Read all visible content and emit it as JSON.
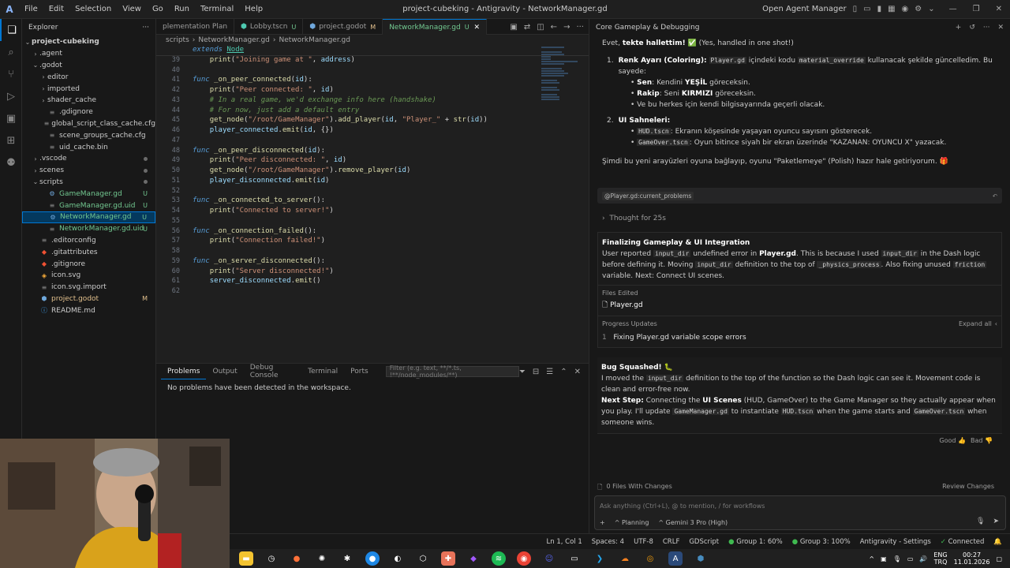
{
  "window": {
    "title": "project-cubeking - Antigravity - NetworkManager.gd",
    "menu": [
      "File",
      "Edit",
      "Selection",
      "View",
      "Go",
      "Run",
      "Terminal",
      "Help"
    ],
    "open_agent_manager": "Open Agent Manager"
  },
  "explorer": {
    "header": "Explorer",
    "root": "project-cubeking",
    "items": [
      {
        "label": ".agent",
        "indent": 1,
        "type": "folder",
        "open": false,
        "status": ""
      },
      {
        "label": ".godot",
        "indent": 1,
        "type": "folder",
        "open": true,
        "status": ""
      },
      {
        "label": "editor",
        "indent": 2,
        "type": "folder",
        "open": false,
        "status": ""
      },
      {
        "label": "imported",
        "indent": 2,
        "type": "folder",
        "open": false,
        "status": ""
      },
      {
        "label": "shader_cache",
        "indent": 2,
        "type": "folder",
        "open": false,
        "status": ""
      },
      {
        "label": ".gdignore",
        "indent": 2,
        "type": "file",
        "status": ""
      },
      {
        "label": "global_script_class_cache.cfg",
        "indent": 2,
        "type": "file",
        "status": ""
      },
      {
        "label": "scene_groups_cache.cfg",
        "indent": 2,
        "type": "file",
        "status": ""
      },
      {
        "label": "uid_cache.bin",
        "indent": 2,
        "type": "file",
        "status": ""
      },
      {
        "label": ".vscode",
        "indent": 1,
        "type": "folder",
        "open": false,
        "status": "dot"
      },
      {
        "label": "scenes",
        "indent": 1,
        "type": "folder",
        "open": false,
        "status": "dot"
      },
      {
        "label": "scripts",
        "indent": 1,
        "type": "folder",
        "open": true,
        "status": "dot"
      },
      {
        "label": "GameManager.gd",
        "indent": 2,
        "type": "file",
        "status": "U"
      },
      {
        "label": "GameManager.gd.uid",
        "indent": 2,
        "type": "file",
        "status": "U"
      },
      {
        "label": "NetworkManager.gd",
        "indent": 2,
        "type": "file",
        "status": "U",
        "selected": true
      },
      {
        "label": "NetworkManager.gd.uid",
        "indent": 2,
        "type": "file",
        "status": "U"
      },
      {
        "label": ".editorconfig",
        "indent": 1,
        "type": "file",
        "status": ""
      },
      {
        "label": ".gitattributes",
        "indent": 1,
        "type": "file",
        "status": ""
      },
      {
        "label": ".gitignore",
        "indent": 1,
        "type": "file",
        "status": ""
      },
      {
        "label": "icon.svg",
        "indent": 1,
        "type": "file",
        "status": ""
      },
      {
        "label": "icon.svg.import",
        "indent": 1,
        "type": "file",
        "status": ""
      },
      {
        "label": "project.godot",
        "indent": 1,
        "type": "file",
        "status": "M"
      },
      {
        "label": "README.md",
        "indent": 1,
        "type": "file",
        "status": ""
      }
    ]
  },
  "tabs": [
    {
      "label": "plementation Plan",
      "status": "",
      "active": false
    },
    {
      "label": "Lobby.tscn",
      "status": "U",
      "active": false
    },
    {
      "label": "project.godot",
      "status": "M",
      "active": false
    },
    {
      "label": "NetworkManager.gd",
      "status": "U",
      "active": true
    }
  ],
  "breadcrumb": [
    "scripts",
    "NetworkManager.gd",
    "NetworkManager.gd"
  ],
  "sticky_line": {
    "kw": "extends",
    "name": "Node"
  },
  "code_lines": [
    {
      "n": "39",
      "t": [
        [
          "",
          "    "
        ],
        [
          "fn",
          "print"
        ],
        [
          "",
          "("
        ],
        [
          "str",
          "\"Joining game at \""
        ],
        [
          "",
          ", "
        ],
        [
          "id",
          "address"
        ],
        [
          "",
          ")"
        ]
      ]
    },
    {
      "n": "40",
      "t": []
    },
    {
      "n": "41",
      "t": [
        [
          "kw",
          "func"
        ],
        [
          "",
          " "
        ],
        [
          "fn",
          "_on_peer_connected"
        ],
        [
          "",
          "("
        ],
        [
          "id",
          "id"
        ],
        [
          "",
          "):"
        ]
      ]
    },
    {
      "n": "42",
      "t": [
        [
          "",
          "    "
        ],
        [
          "fn",
          "print"
        ],
        [
          "",
          "("
        ],
        [
          "str",
          "\"Peer connected: \""
        ],
        [
          "",
          ", "
        ],
        [
          "id",
          "id"
        ],
        [
          "",
          ")"
        ]
      ]
    },
    {
      "n": "43",
      "t": [
        [
          "cm",
          "    # In a real game, we'd exchange info here (handshake)"
        ]
      ]
    },
    {
      "n": "44",
      "t": [
        [
          "cm",
          "    # For now, just add a default entry"
        ]
      ]
    },
    {
      "n": "45",
      "t": [
        [
          "",
          "    "
        ],
        [
          "fn",
          "get_node"
        ],
        [
          "",
          "("
        ],
        [
          "str",
          "\"/root/GameManager\""
        ],
        [
          "",
          ")."
        ],
        [
          "fn",
          "add_player"
        ],
        [
          "",
          "("
        ],
        [
          "id",
          "id"
        ],
        [
          "",
          ", "
        ],
        [
          "str",
          "\"Player_\""
        ],
        [
          "",
          " + "
        ],
        [
          "fn",
          "str"
        ],
        [
          "",
          "("
        ],
        [
          "id",
          "id"
        ],
        [
          "",
          "))"
        ]
      ]
    },
    {
      "n": "46",
      "t": [
        [
          "",
          "    "
        ],
        [
          "id",
          "player_connected"
        ],
        [
          "",
          "."
        ],
        [
          "fn",
          "emit"
        ],
        [
          "",
          "("
        ],
        [
          "id",
          "id"
        ],
        [
          "",
          ", {})"
        ]
      ]
    },
    {
      "n": "47",
      "t": []
    },
    {
      "n": "48",
      "t": [
        [
          "kw",
          "func"
        ],
        [
          "",
          " "
        ],
        [
          "fn",
          "_on_peer_disconnected"
        ],
        [
          "",
          "("
        ],
        [
          "id",
          "id"
        ],
        [
          "",
          "):"
        ]
      ]
    },
    {
      "n": "49",
      "t": [
        [
          "",
          "    "
        ],
        [
          "fn",
          "print"
        ],
        [
          "",
          "("
        ],
        [
          "str",
          "\"Peer disconnected: \""
        ],
        [
          "",
          ", "
        ],
        [
          "id",
          "id"
        ],
        [
          "",
          ")"
        ]
      ]
    },
    {
      "n": "50",
      "t": [
        [
          "",
          "    "
        ],
        [
          "fn",
          "get_node"
        ],
        [
          "",
          "("
        ],
        [
          "str",
          "\"/root/GameManager\""
        ],
        [
          "",
          ")."
        ],
        [
          "fn",
          "remove_player"
        ],
        [
          "",
          "("
        ],
        [
          "id",
          "id"
        ],
        [
          "",
          ")"
        ]
      ]
    },
    {
      "n": "51",
      "t": [
        [
          "",
          "    "
        ],
        [
          "id",
          "player_disconnected"
        ],
        [
          "",
          "."
        ],
        [
          "fn",
          "emit"
        ],
        [
          "",
          "("
        ],
        [
          "id",
          "id"
        ],
        [
          "",
          ")"
        ]
      ]
    },
    {
      "n": "52",
      "t": []
    },
    {
      "n": "53",
      "t": [
        [
          "kw",
          "func"
        ],
        [
          "",
          " "
        ],
        [
          "fn",
          "_on_connected_to_server"
        ],
        [
          "",
          "():"
        ]
      ]
    },
    {
      "n": "54",
      "t": [
        [
          "",
          "    "
        ],
        [
          "fn",
          "print"
        ],
        [
          "",
          "("
        ],
        [
          "str",
          "\"Connected to server!\""
        ],
        [
          "",
          ")"
        ]
      ]
    },
    {
      "n": "55",
      "t": []
    },
    {
      "n": "56",
      "t": [
        [
          "kw",
          "func"
        ],
        [
          "",
          " "
        ],
        [
          "fn",
          "_on_connection_failed"
        ],
        [
          "",
          "():"
        ]
      ]
    },
    {
      "n": "57",
      "t": [
        [
          "",
          "    "
        ],
        [
          "fn",
          "print"
        ],
        [
          "",
          "("
        ],
        [
          "str",
          "\"Connection failed!\""
        ],
        [
          "",
          ")"
        ]
      ]
    },
    {
      "n": "58",
      "t": []
    },
    {
      "n": "59",
      "t": [
        [
          "kw",
          "func"
        ],
        [
          "",
          " "
        ],
        [
          "fn",
          "_on_server_disconnected"
        ],
        [
          "",
          "():"
        ]
      ]
    },
    {
      "n": "60",
      "t": [
        [
          "",
          "    "
        ],
        [
          "fn",
          "print"
        ],
        [
          "",
          "("
        ],
        [
          "str",
          "\"Server disconnected!\""
        ],
        [
          "",
          ")"
        ]
      ]
    },
    {
      "n": "61",
      "t": [
        [
          "",
          "    "
        ],
        [
          "id",
          "server_disconnected"
        ],
        [
          "",
          "."
        ],
        [
          "fn",
          "emit"
        ],
        [
          "",
          "()"
        ]
      ]
    },
    {
      "n": "62",
      "t": []
    }
  ],
  "panel": {
    "tabs": [
      "Problems",
      "Output",
      "Debug Console",
      "Terminal",
      "Ports"
    ],
    "filter_placeholder": "Filter (e.g. text, **/*.ts, !**/node_modules/**)",
    "message": "No problems have been detected in the workspace."
  },
  "agent": {
    "header": "Core Gameplay & Debugging",
    "intro_pre": "Evet, ",
    "intro_bold": "tekte hallettim!",
    "intro_post": " ✅ (Yes, handled in one shot!)",
    "item1_bold": "Renk Ayarı (Coloring):",
    "item1_code1": "Player.gd",
    "item1_mid": " içindeki kodu ",
    "item1_code2": "material_override",
    "item1_post": " kullanacak şekilde güncelledim. Bu sayede:",
    "b1_bold": "Sen",
    "b1_pre": ": Kendini ",
    "b1_bold2": "YEŞİL",
    "b1_post": " göreceksin.",
    "b2_bold": "Rakip",
    "b2_pre": ": Seni ",
    "b2_bold2": "KIRMIZI",
    "b2_post": " göreceksin.",
    "b3": "Ve bu herkes için kendi bilgisayarında geçerli olacak.",
    "item2_bold": "UI Sahneleri:",
    "c1_code": "HUD.tscn",
    "c1_post": ": Ekranın köşesinde yaşayan oyuncu sayısını gösterecek.",
    "c2_code": "GameOver.tscn",
    "c2_post": ": Oyun bitince siyah bir ekran üzerinde \"KAZANAN: OYUNCU X\" yazacak.",
    "closing": "Şimdi bu yeni arayüzleri oyuna bağlayıp, oyunu \"Paketlemeye\" (Polish) hazır hale getiriyorum. 🎁",
    "mention": "@Player.gd:current_problems",
    "thought": "Thought for 25s",
    "task_title": "Finalizing Gameplay & UI Integration",
    "task_t1": "User reported ",
    "task_c1": "input_dir",
    "task_t2": " undefined error in ",
    "task_file": "Player.gd",
    "task_t3": ". This is because I used ",
    "task_c2": "input_dir",
    "task_t4": " in the Dash logic before defining it. Moving ",
    "task_c3": "input_dir",
    "task_t5": " definition to the top of ",
    "task_c4": "_physics_process",
    "task_t6": ". Also fixing unused ",
    "task_c5": "friction",
    "task_t7": " variable. Next: Connect UI scenes.",
    "files_edited_label": "Files Edited",
    "files_edited": "Player.gd",
    "progress_label": "Progress Updates",
    "expand_all": "Expand all",
    "progress_item": "Fixing Player.gd variable scope errors",
    "bug_title": "Bug Squashed! 🐛",
    "bug_t1": "I moved the ",
    "bug_c1": "input_dir",
    "bug_t2": " definition to the top of the function so the Dash logic can see it. Movement code is clean and error-free now.",
    "next_bold": "Next Step:",
    "next_t1": " Connecting the ",
    "next_b2": "UI Scenes",
    "next_t2": " (HUD, GameOver) to the Game Manager so they actually appear when you play. I'll update ",
    "next_c1": "GameManager.gd",
    "next_t3": " to instantiate ",
    "next_c2": "HUD.tscn",
    "next_t4": " when the game starts and ",
    "next_c3": "GameOver.tscn",
    "next_t5": " when someone wins.",
    "good": "Good",
    "bad": "Bad",
    "files_changes": "0 Files With Changes",
    "review_changes": "Review Changes",
    "input_placeholder": "Ask anything (Ctrl+L), @ to mention, / for workflows",
    "mode": "Planning",
    "model": "Gemini 3 Pro (High)"
  },
  "statusbar": {
    "position": "Ln 1, Col 1",
    "spaces": "Spaces: 4",
    "encoding": "UTF-8",
    "eol": "CRLF",
    "language": "GDScript",
    "group1": "Group 1: 60%",
    "group3": "Group 3: 100%",
    "settings": "Antigravity - Settings",
    "connected": "Connected"
  },
  "taskbar": {
    "lang1": "ENG",
    "lang2": "TRQ",
    "time": "00:27",
    "date": "11.01.2026"
  },
  "colors": {
    "accent": "#0078d4",
    "untracked": "#73c991",
    "modified": "#e2c08d",
    "connected": "#3fb950"
  }
}
